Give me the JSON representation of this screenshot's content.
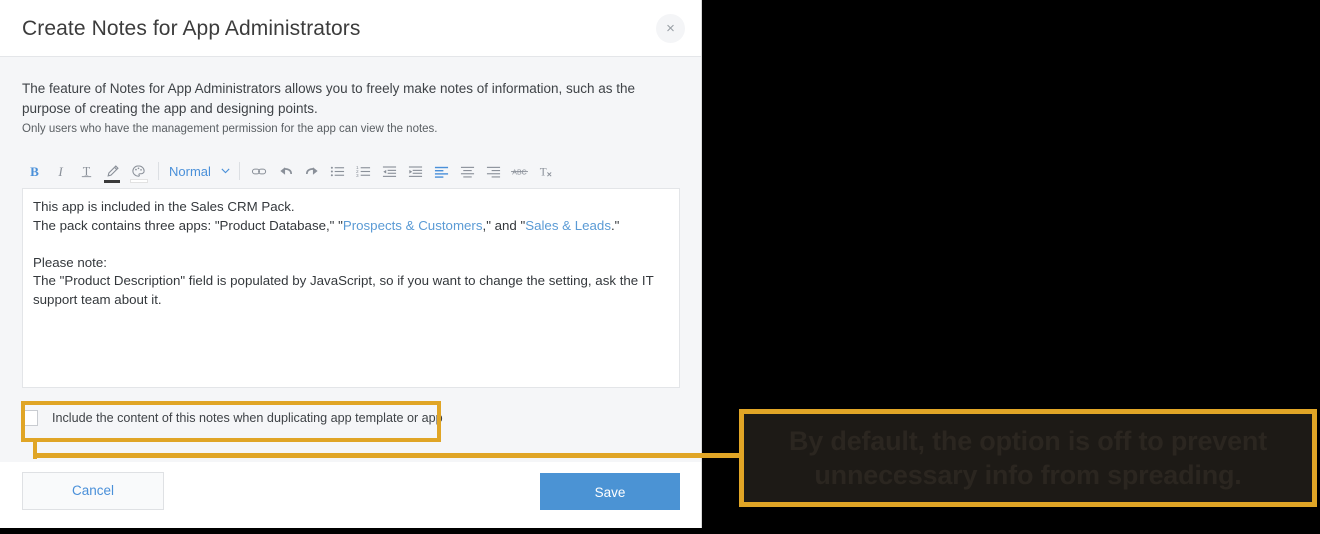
{
  "dialog": {
    "title": "Create Notes for App Administrators",
    "close_icon": "×",
    "description_main": "The feature of Notes for App Administrators allows you to freely make notes of information, such as the purpose of creating the app and designing points.",
    "description_sub": "Only users who have the management permission for the app can view the notes."
  },
  "toolbar": {
    "style_label": "Normal",
    "items": [
      {
        "name": "bold",
        "label": "B",
        "active": true
      },
      {
        "name": "italic",
        "label": "I",
        "active": false
      },
      {
        "name": "underline",
        "label": "T",
        "active": false
      },
      {
        "name": "text-color",
        "label": "pencil",
        "active": false
      },
      {
        "name": "background-color",
        "label": "palette",
        "active": false
      },
      {
        "name": "link",
        "label": "link",
        "active": false
      },
      {
        "name": "undo",
        "label": "undo",
        "active": false
      },
      {
        "name": "redo",
        "label": "redo",
        "active": false
      },
      {
        "name": "bulleted-list",
        "label": "bullets",
        "active": false
      },
      {
        "name": "numbered-list",
        "label": "numbers",
        "active": false
      },
      {
        "name": "outdent",
        "label": "outdent",
        "active": false
      },
      {
        "name": "indent",
        "label": "indent",
        "active": false
      },
      {
        "name": "align-left",
        "label": "align left",
        "active": true
      },
      {
        "name": "align-center",
        "label": "align center",
        "active": false
      },
      {
        "name": "align-right",
        "label": "align right",
        "active": false
      },
      {
        "name": "strikethrough",
        "label": "ABC",
        "active": false
      },
      {
        "name": "clear-format",
        "label": "Tx",
        "active": false
      }
    ]
  },
  "editor": {
    "line1": "This app is included in the Sales CRM Pack.",
    "line2_part1": "The pack contains three apps: \"Product Database,\" \"",
    "line2_link1": "Prospects & Customers",
    "line2_part2": ",\" and \"",
    "line2_link2": "Sales & Leads",
    "line2_part3": ".\"",
    "line3": "Please note:",
    "line4": "The \"Product Description\" field is populated by JavaScript, so if you want to change the setting, ask the IT support team about it."
  },
  "checkbox": {
    "label": "Include the content of this notes when duplicating app template or app",
    "checked": false
  },
  "footer": {
    "cancel_label": "Cancel",
    "save_label": "Save"
  },
  "annotation": {
    "text": "By default, the option is off to prevent unnecessary info from spreading.",
    "accent_color": "#e0a526",
    "background_color": "#1d1a16"
  },
  "colors": {
    "primary_blue": "#4b93d4",
    "link_blue": "#5b9bd5",
    "body_background": "#f5f6f8",
    "canvas_background": "#000000"
  }
}
